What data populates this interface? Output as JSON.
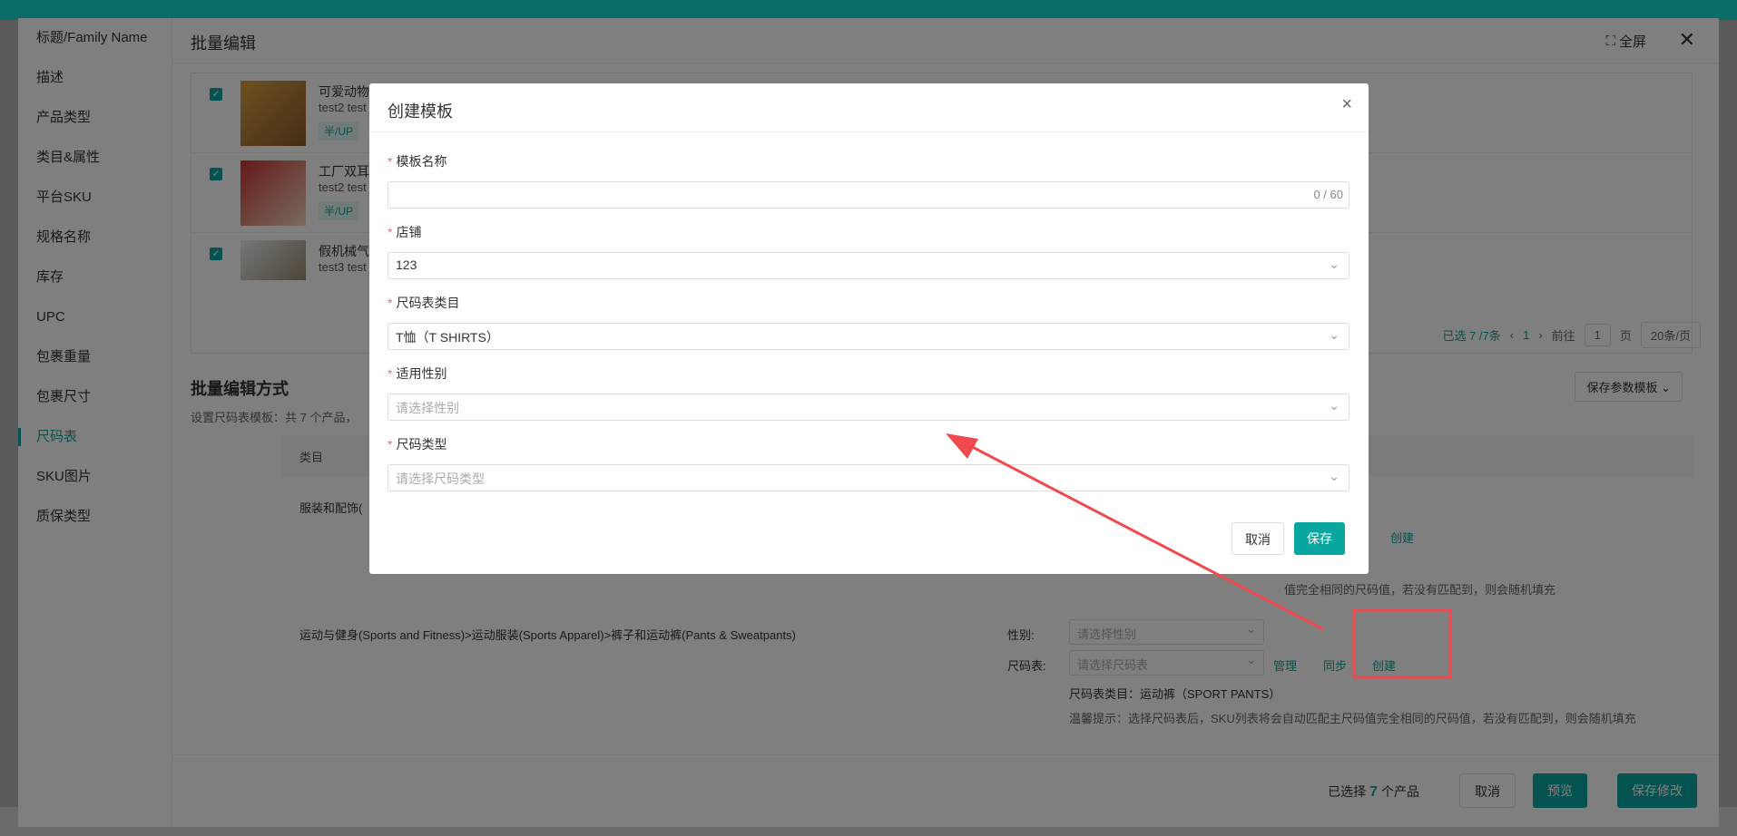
{
  "drawer": {
    "title": "批量编辑",
    "fullscreen_label": "全屏",
    "sidebar": [
      {
        "label": "标题/Family Name"
      },
      {
        "label": "描述"
      },
      {
        "label": "产品类型"
      },
      {
        "label": "类目&属性"
      },
      {
        "label": "平台SKU"
      },
      {
        "label": "规格名称"
      },
      {
        "label": "库存"
      },
      {
        "label": "UPC"
      },
      {
        "label": "包裹重量"
      },
      {
        "label": "包裹尺寸"
      },
      {
        "label": "尺码表",
        "active": true
      },
      {
        "label": "SKU图片"
      },
      {
        "label": "质保类型"
      }
    ],
    "products": [
      {
        "title": "可爱动物青",
        "sub": "test2 test",
        "tag": "半/UP"
      },
      {
        "title": "工厂双耳珐",
        "sub": "test2 test",
        "tag": "半/UP"
      },
      {
        "title": "假机械气球",
        "sub": "test3 test"
      }
    ],
    "pager": {
      "selected": "已选 7 /7条",
      "page": "1",
      "goto_label": "前往",
      "goto_value": "1",
      "page_unit": "页",
      "page_size": "20条/页"
    },
    "section_title": "批量编辑方式",
    "section_sub": "设置尺码表模板：共 7 个产品，",
    "save_template_label": "保存参数模板",
    "table_header": "类目",
    "rows": [
      {
        "category": "服装和配饰("
      },
      {
        "category": "运动与健身(Sports and Fitness)>运动服装(Sports Apparel)>裤子和运动裤(Pants & Sweatpants)",
        "gender_label": "性别:",
        "gender_placeholder": "请选择性别",
        "size_label": "尺码表:",
        "size_placeholder": "请选择尺码表",
        "manage": "管理",
        "sync": "同步",
        "create": "创建",
        "size_category": "尺码表类目：运动裤（SPORT PANTS）",
        "hint": "温馨提示：选择尺码表后，SKU列表将会自动匹配主尺码值完全相同的尺码值，若没有匹配到，则会随机填充"
      }
    ],
    "row1_create": "创建",
    "row1_hint_tail": "值完全相同的尺码值，若没有匹配到，则会随机填充",
    "footer": {
      "selected_prefix": "已选择",
      "selected_count": "7",
      "selected_suffix": "个产品",
      "cancel": "取消",
      "preview": "预览",
      "save": "保存修改"
    }
  },
  "modal": {
    "title": "创建模板",
    "fields": {
      "name": {
        "label": "模板名称",
        "value": "",
        "counter": "0 / 60"
      },
      "store": {
        "label": "店铺",
        "value": "123"
      },
      "size_category": {
        "label": "尺码表类目",
        "value": "T恤（T SHIRTS）"
      },
      "gender": {
        "label": "适用性别",
        "placeholder": "请选择性别"
      },
      "size_type": {
        "label": "尺码类型",
        "placeholder": "请选择尺码类型"
      }
    },
    "cancel": "取消",
    "save": "保存"
  },
  "background": {
    "bottom_text": "已选 7 /7条"
  },
  "colors": {
    "primary": "#0aa7a0",
    "annotation": "#f0494e",
    "topbar": "#0b6d68"
  }
}
